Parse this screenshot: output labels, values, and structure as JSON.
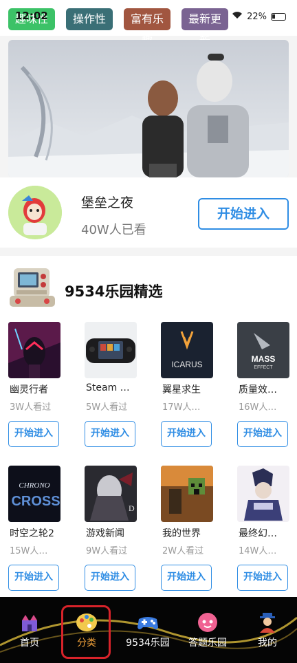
{
  "status": {
    "time": "12:02",
    "battery": "22%"
  },
  "tags": [
    {
      "label": "趣味性",
      "color": "#3cc267"
    },
    {
      "label": "操作性",
      "color": "#3a6f76"
    },
    {
      "label": "富有乐趣",
      "color": "#a15640"
    },
    {
      "label": "最新更新",
      "color": "#7a6392"
    }
  ],
  "featured": {
    "title": "堡垒之夜",
    "subtitle": "40W人已看",
    "button": "开始进入"
  },
  "section": {
    "title": "9534乐园精选"
  },
  "cards": [
    {
      "name": "幽灵行者",
      "views": "3W人看过",
      "button": "开始进入",
      "thumb": "ghostrunner"
    },
    {
      "name": "Steam …",
      "views": "5W人看过",
      "button": "开始进入",
      "thumb": "steamdeck"
    },
    {
      "name": "翼星求生",
      "views": "17W人…",
      "button": "开始进入",
      "thumb": "icarus",
      "thumb_text": "ICARUS"
    },
    {
      "name": "质量效…",
      "views": "16W人…",
      "button": "开始进入",
      "thumb": "masseffect",
      "thumb_text": "MASS",
      "thumb_text2": "EFFECT"
    },
    {
      "name": "时空之轮2",
      "views": "15W人…",
      "button": "开始进入",
      "thumb": "chronocross",
      "thumb_text": "CHRONO",
      "thumb_text2": "CROSS"
    },
    {
      "name": "游戏新闻",
      "views": "9W人看过",
      "button": "开始进入",
      "thumb": "gamenews"
    },
    {
      "name": "我的世界",
      "views": "2W人看过",
      "button": "开始进入",
      "thumb": "minecraft"
    },
    {
      "name": "最终幻…",
      "views": "14W人…",
      "button": "开始进入",
      "thumb": "finalfantasy"
    }
  ],
  "nav": [
    {
      "label": "首页",
      "icon": "castle-icon"
    },
    {
      "label": "分类",
      "icon": "palette-icon",
      "active": true
    },
    {
      "label": "9534乐园",
      "icon": "gamepad-icon"
    },
    {
      "label": "答题乐园",
      "icon": "mascot-icon"
    },
    {
      "label": "我的",
      "icon": "avatar-icon"
    }
  ],
  "colors": {
    "accent": "#2f8de4",
    "highlight": "#d8232a"
  }
}
